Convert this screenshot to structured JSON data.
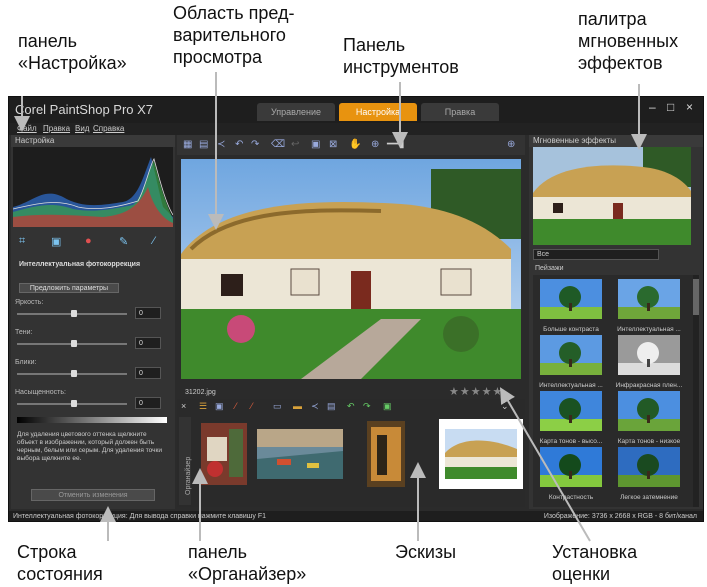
{
  "callouts": {
    "settings_panel": "панель «Настройка»",
    "preview_area": "Область пред-варительного просмотра",
    "tools_panel": "Панель инструментов",
    "instant_effects": "палитра мгновенных эффектов",
    "status_bar": "Строка состояния",
    "organizer": "панель «Органайзер»",
    "thumbnails": "Эскизы",
    "rating": "Установка оценки"
  },
  "callout_lines": {
    "settings_panel": [
      "панель",
      "«Настройка»"
    ],
    "preview_area": [
      "Область пред-",
      "варительного",
      "просмотра"
    ],
    "tools_panel": [
      "Панель",
      "инструментов"
    ],
    "instant_effects": [
      "палитра",
      "мгновенных",
      "эффектов"
    ],
    "status_bar": [
      "Строка",
      "состояния"
    ],
    "organizer": [
      "панель",
      "«Органайзер»"
    ],
    "thumbnails": [
      "Эскизы"
    ],
    "rating": [
      "Установка",
      "оценки"
    ]
  },
  "app": {
    "title": "Corel PaintShop Pro X7",
    "tabs": [
      {
        "label": "Управление",
        "active": false
      },
      {
        "label": "Настройка",
        "active": true
      },
      {
        "label": "Правка",
        "active": false
      }
    ],
    "window_controls": [
      "–",
      "□",
      "×"
    ]
  },
  "menu": [
    "Файл",
    "Правка",
    "Вид",
    "Справка"
  ],
  "left_panel": {
    "header": "Настройка",
    "section_title": "Интеллектуальная фотокоррекция",
    "suggest_button": "Предложить параметры",
    "sliders": [
      {
        "label": "Яркость:",
        "value": "0"
      },
      {
        "label": "Тени:",
        "value": "0"
      },
      {
        "label": "Блики:",
        "value": "0"
      },
      {
        "label": "Насыщенность:",
        "value": "0"
      }
    ],
    "help": "Для удаления цветового оттенка щелкните объект в изображении, который должен быть черным, белым или серым. Для удаления точки выбора щелкните ее.",
    "reset_button": "Отменить изменения"
  },
  "preview": {
    "filename": "31202.jpg",
    "rating": 0,
    "rating_max": 5
  },
  "organizer": {
    "side_label": "Органайзер",
    "thumbnails": [
      "thumb-1",
      "thumb-2",
      "thumb-3",
      "thumb-4"
    ]
  },
  "right_panel": {
    "header": "Мгновенные эффекты",
    "filter": "Все",
    "category": "Пейзажи",
    "effects": [
      "Больше контраста",
      "Интеллектуальная ...",
      "Интеллектуальная ...",
      "Инфракрасная плен...",
      "Карта тонов - высо...",
      "Карта тонов - низкое",
      "Контрастность",
      "Легкое затемнение"
    ]
  },
  "status": {
    "left": "Интеллектуальная фотокоррекция: Для вывода справки нажмите клавишу F1",
    "right": "Изображение: 3736 x 2668 x RGB - 8 бит/канал"
  },
  "colors": {
    "accent": "#e8930f",
    "window_bg": "#2b2b2b",
    "panel_bg": "#333333"
  }
}
